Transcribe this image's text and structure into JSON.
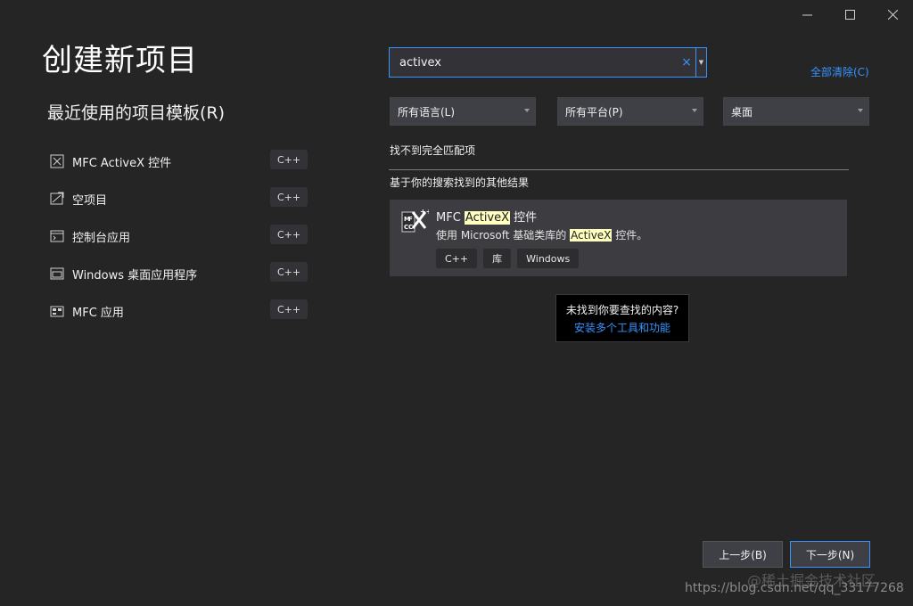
{
  "page_title": "创建新项目",
  "recent": {
    "title": "最近使用的项目模板(R)",
    "items": [
      {
        "label": "MFC ActiveX 控件",
        "lang": "C++",
        "icon": "mfc-activex-icon"
      },
      {
        "label": "空项目",
        "lang": "C++",
        "icon": "empty-project-icon"
      },
      {
        "label": "控制台应用",
        "lang": "C++",
        "icon": "console-app-icon"
      },
      {
        "label": "Windows 桌面应用程序",
        "lang": "C++",
        "icon": "windows-desktop-icon"
      },
      {
        "label": "MFC 应用",
        "lang": "C++",
        "icon": "mfc-app-icon"
      }
    ]
  },
  "search": {
    "value": "activex",
    "clear_glyph": "×"
  },
  "clear_all": "全部清除(C)",
  "filters": {
    "language": "所有语言(L)",
    "platform": "所有平台(P)",
    "project_type": "桌面"
  },
  "no_match": "找不到完全匹配项",
  "other_results": "基于你的搜索找到的其他结果",
  "result": {
    "title_prefix": "MFC ",
    "title_highlight": "ActiveX",
    "title_suffix": " 控件",
    "desc_prefix": "使用 Microsoft 基础类库的 ",
    "desc_highlight": "ActiveX",
    "desc_suffix": " 控件。",
    "tags": [
      "C++",
      "库",
      "Windows"
    ]
  },
  "tooltip": {
    "question": "未找到你要查找的内容?",
    "link": "安装多个工具和功能"
  },
  "buttons": {
    "back": "上一步(B)",
    "next": "下一步(N)"
  },
  "watermark": {
    "line1": "@稀土掘金技术社区",
    "line2": "https://blog.csdn.net/qq_33177268"
  },
  "colors": {
    "background": "#252526",
    "accent": "#3794ff",
    "highlight": "#ffffbf"
  }
}
